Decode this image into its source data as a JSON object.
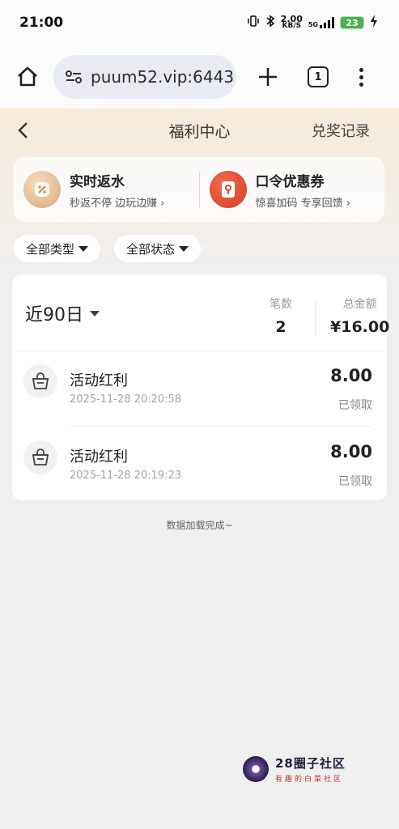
{
  "status_bar": {
    "time": "21:00",
    "net_speed_value": "2.00",
    "net_speed_unit": "KB/S",
    "network_type": "5G",
    "battery": "23"
  },
  "browser": {
    "url": "puum52.vip:6443",
    "tab_count": "1"
  },
  "header": {
    "title": "福利中心",
    "redeem_label": "兑奖记录"
  },
  "promos": [
    {
      "title": "实时返水",
      "subtitle": "秒返不停 边玩边赚 ›"
    },
    {
      "title": "口令优惠券",
      "subtitle": "惊喜加码 专享回馈 ›"
    }
  ],
  "filters": {
    "type": "全部类型",
    "status": "全部状态"
  },
  "summary": {
    "period": "近90日",
    "count_label": "笔数",
    "count_value": "2",
    "total_label": "总金额",
    "total_value": "¥16.00"
  },
  "records": [
    {
      "name": "活动红利",
      "time": "2025-11-28 20:20:58",
      "amount": "8.00",
      "status": "已领取"
    },
    {
      "name": "活动红利",
      "time": "2025-11-28 20:19:23",
      "amount": "8.00",
      "status": "已领取"
    }
  ],
  "footer_text": "数据加载完成~",
  "watermark": {
    "title": "28圈子社区",
    "subtitle": "有趣的白菜社区"
  },
  "colors": {
    "page_bg": "#efefef",
    "promo_red": "#e04a30",
    "promo_gold": "#d8a678",
    "battery": "#4cb050"
  }
}
